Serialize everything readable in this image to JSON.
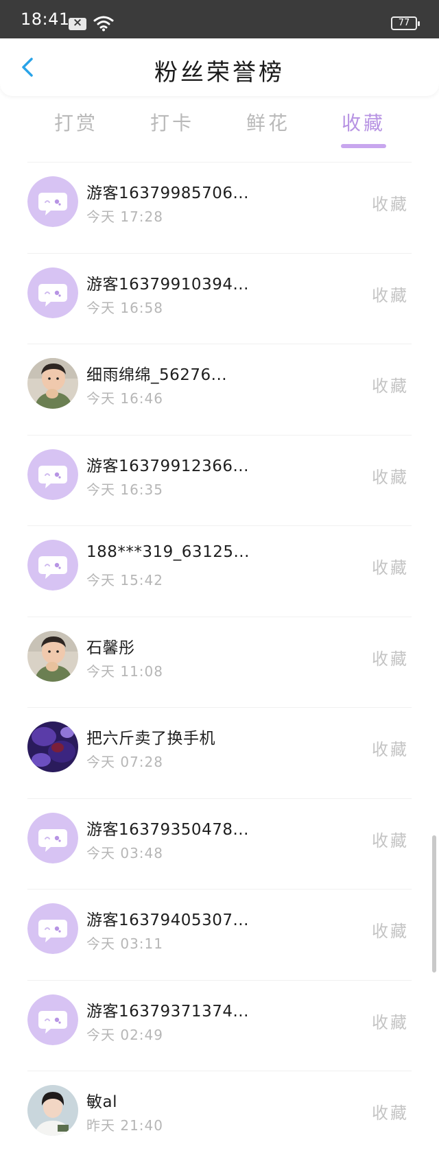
{
  "status_bar": {
    "time": "18:41",
    "battery": "77"
  },
  "header": {
    "title": "粉丝荣誉榜"
  },
  "tabs": [
    {
      "label": "打赏",
      "active": false
    },
    {
      "label": "打卡",
      "active": false
    },
    {
      "label": "鲜花",
      "active": false
    },
    {
      "label": "收藏",
      "active": true
    }
  ],
  "list": [
    {
      "name": "游客16379985706...",
      "time": "今天 17:28",
      "action": "收藏",
      "avatar": "default-chat-icon"
    },
    {
      "name": "游客16379910394...",
      "time": "今天 16:58",
      "action": "收藏",
      "avatar": "default-chat-icon"
    },
    {
      "name": "细雨绵绵_56276...",
      "time": "今天 16:46",
      "action": "收藏",
      "avatar": "child-photo"
    },
    {
      "name": "游客16379912366...",
      "time": "今天 16:35",
      "action": "收藏",
      "avatar": "default-chat-icon"
    },
    {
      "name": "188***319_63125...",
      "time": "今天 15:42",
      "action": "收藏",
      "avatar": "default-chat-icon"
    },
    {
      "name": "石馨彤",
      "time": "今天 11:08",
      "action": "收藏",
      "avatar": "child-photo"
    },
    {
      "name": "把六斤卖了换手机",
      "time": "今天 07:28",
      "action": "收藏",
      "avatar": "abstract-purple-photo"
    },
    {
      "name": "游客16379350478...",
      "time": "今天 03:48",
      "action": "收藏",
      "avatar": "default-chat-icon"
    },
    {
      "name": "游客16379405307...",
      "time": "今天 03:11",
      "action": "收藏",
      "avatar": "default-chat-icon"
    },
    {
      "name": "游客16379371374...",
      "time": "今天 02:49",
      "action": "收藏",
      "avatar": "default-chat-icon"
    },
    {
      "name": "敏al",
      "time": "昨天 21:40",
      "action": "收藏",
      "avatar": "person-photo"
    }
  ],
  "colors": {
    "accent": "#b793e3",
    "avatar_bg": "#d7c3f3",
    "status_bar": "#3b3b3b"
  }
}
